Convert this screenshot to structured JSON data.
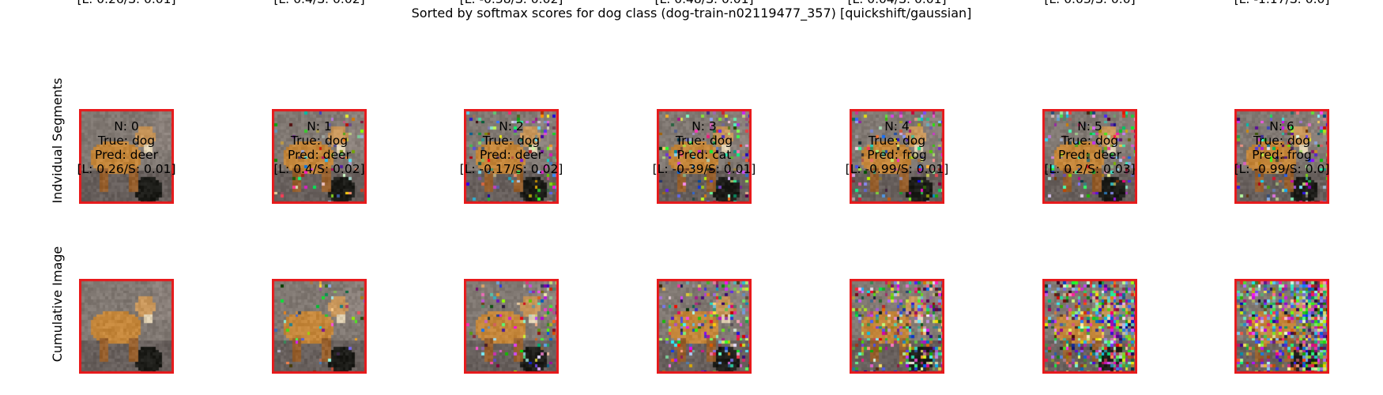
{
  "title": "Sorted by softmax scores for dog class (dog-train-n02119477_357) [quickshift/gaussian]",
  "chart_data": {
    "type": "image-grid",
    "rows": [
      {
        "label": "Indvidual Segments",
        "key": "seg",
        "panels": [
          {
            "n": "N: 0",
            "true": "True: dog",
            "pred": "Pred: deer",
            "score": "[L: 0.26/S: 0.01]",
            "noise": 0.0
          },
          {
            "n": "N: 1",
            "true": "True: dog",
            "pred": "Pred: deer",
            "score": "[L: 0.4/S: 0.02]",
            "noise": 0.08
          },
          {
            "n": "N: 2",
            "true": "True: dog",
            "pred": "Pred: deer",
            "score": "[L: -0.58/S: 0.02]",
            "noise": 0.14
          },
          {
            "n": "N: 3",
            "true": "True: dog",
            "pred": "Pred: cat",
            "score": "[L: 0.48/S: 0.01]",
            "noise": 0.16
          },
          {
            "n": "N: 4",
            "true": "True: dog",
            "pred": "Pred: deer",
            "score": "[L: 0.04/S: 0.01]",
            "noise": 0.18
          },
          {
            "n": "N: 5",
            "true": "True: dog",
            "pred": "Pred: deer",
            "score": "[L: 0.03/S: 0.0]",
            "noise": 0.18
          },
          {
            "n": "N: 6",
            "true": "True: dog",
            "pred": "Pred: frog",
            "score": "[L: -1.17/S: 0.0]",
            "noise": 0.2
          }
        ]
      },
      {
        "label": "Cumulative Image",
        "key": "cum",
        "panels": [
          {
            "n": "N: 0",
            "true": "True: dog",
            "pred": "Pred: deer",
            "score": "[L: 0.26/S: 0.01]",
            "noise": 0.0
          },
          {
            "n": "N: 1",
            "true": "True: dog",
            "pred": "Pred: deer",
            "score": "[L: 0.4/S: 0.02]",
            "noise": 0.08
          },
          {
            "n": "N: 2",
            "true": "True: dog",
            "pred": "Pred: deer",
            "score": "[L: -0.17/S: 0.02]",
            "noise": 0.18
          },
          {
            "n": "N: 3",
            "true": "True: dog",
            "pred": "Pred: cat",
            "score": "[L: -0.39/S: 0.01]",
            "noise": 0.32
          },
          {
            "n": "N: 4",
            "true": "True: dog",
            "pred": "Pred: frog",
            "score": "[L: -0.99/S: 0.01]",
            "noise": 0.48
          },
          {
            "n": "N: 5",
            "true": "True: dog",
            "pred": "Pred: deer",
            "score": "[L: 0.2/S: 0.03]",
            "noise": 0.62
          },
          {
            "n": "N: 6",
            "true": "True: dog",
            "pred": "Pred: frog",
            "score": "[L: -0.99/S: 0.0]",
            "noise": 0.8
          }
        ]
      }
    ]
  },
  "colors": {
    "frame": "#e8191b",
    "background": "#ffffff"
  }
}
